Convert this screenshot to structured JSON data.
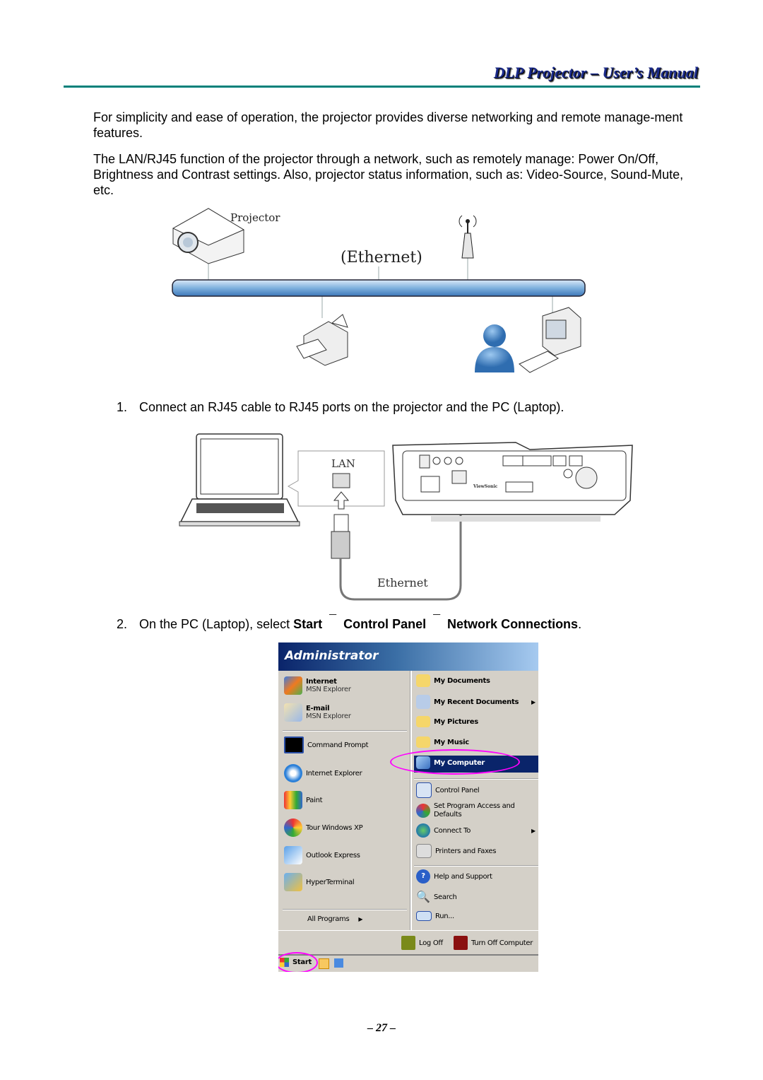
{
  "header": {
    "title": "DLP Projector – User’s Manual",
    "rule_color": "#00807a"
  },
  "paragraphs": [
    "For simplicity and ease of operation, the projector provides diverse networking and remote manage-ment features.",
    "The LAN/RJ45 function of the projector through a network, such as remotely manage: Power On/Off, Brightness and Contrast settings. Also, projector status information, such as: Video-Source, Sound-Mute, etc."
  ],
  "diagram1": {
    "projector_label": "Projector",
    "network_label": "(Ethernet)"
  },
  "steps": [
    {
      "num": "1.",
      "text": "Connect an RJ45 cable to RJ45 ports on the projector and the PC (Laptop)."
    },
    {
      "num": "2.",
      "pre": "On the PC (Laptop), select ",
      "a": "Start",
      "b": "Control Panel",
      "c": "Network Connections",
      "post": ".",
      "arrow": "¯"
    }
  ],
  "diagram2": {
    "lan_label": "LAN",
    "cable_label": "Ethernet",
    "brand": "ViewSonic"
  },
  "start_menu": {
    "user": "Administrator",
    "left_pinned": [
      {
        "title": "Internet",
        "sub": "MSN Explorer",
        "icon": "msn-butterfly-icon"
      },
      {
        "title": "E-mail",
        "sub": "MSN Explorer",
        "icon": "email-envelope-icon"
      }
    ],
    "left_recent": [
      {
        "label": "Command Prompt",
        "icon": "command-prompt-icon"
      },
      {
        "label": "Internet Explorer",
        "icon": "internet-explorer-icon"
      },
      {
        "label": "Paint",
        "icon": "paint-icon"
      },
      {
        "label": "Tour Windows XP",
        "icon": "tour-icon"
      },
      {
        "label": "Outlook Express",
        "icon": "outlook-express-icon"
      },
      {
        "label": "HyperTerminal",
        "icon": "hyperterminal-icon"
      }
    ],
    "all_programs": "All Programs",
    "right_top": [
      {
        "label": "My Documents",
        "icon": "folder-documents-icon"
      },
      {
        "label": "My Recent Documents",
        "icon": "recent-documents-icon"
      },
      {
        "label": "My Pictures",
        "icon": "folder-icon"
      },
      {
        "label": "My Music",
        "icon": "folder-icon"
      },
      {
        "label": "My Computer",
        "icon": "my-computer-icon",
        "selected": true
      }
    ],
    "right_mid": [
      {
        "label": "Control Panel",
        "icon": "control-panel-icon"
      },
      {
        "label": "Set Program Access and Defaults",
        "icon": "program-access-icon"
      },
      {
        "label": "Connect To",
        "icon": "connect-to-icon"
      },
      {
        "label": "Printers and Faxes",
        "icon": "printer-icon"
      }
    ],
    "right_bottom": [
      {
        "label": "Help and Support",
        "icon": "help-icon"
      },
      {
        "label": "Search",
        "icon": "search-icon"
      },
      {
        "label": "Run...",
        "icon": "run-icon"
      }
    ],
    "log_off": "Log Off",
    "turn_off": "Turn Off Computer",
    "start": "Start",
    "highlight_color": "#ff00ff",
    "selected_color": "#0a246a"
  },
  "page_number": "– 27 –"
}
